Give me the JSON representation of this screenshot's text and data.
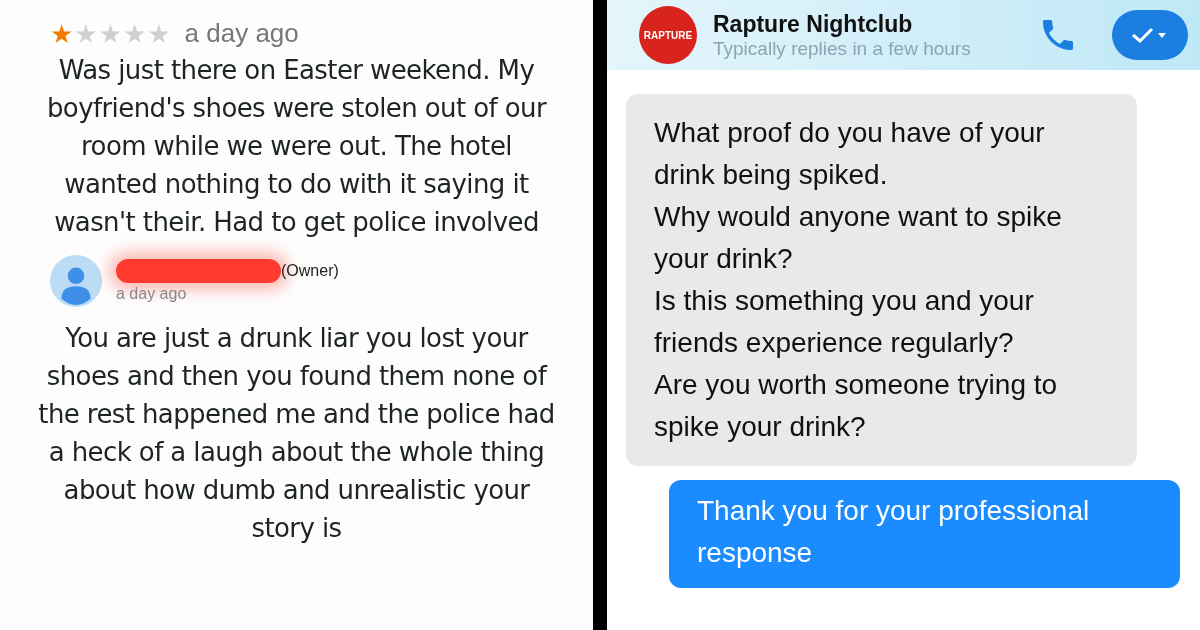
{
  "review": {
    "stars": 1,
    "time": "a day ago",
    "text": "Was just there on Easter weekend. My boyfriend's shoes were stolen out of our room while we were out. The hotel wanted nothing to do with it saying it wasn't their. Had to get police involved"
  },
  "owner_reply": {
    "role": "(Owner)",
    "time": "a day ago",
    "text": "You are just a drunk liar you lost your shoes and then you found them none of the rest happened me and the police had a heck of a laugh about the whole thing about how dumb and unrealistic your story is"
  },
  "chat": {
    "logo": "RAPTURE",
    "name": "Rapture Nightclub",
    "status": "Typically replies in a few hours",
    "messages": [
      {
        "kind": "received",
        "text": "What proof do you have of your drink being spiked.\nWhy would anyone want to spike your drink?\nIs this something you and your friends experience regularly?\nAre you worth someone trying to spike your drink?"
      },
      {
        "kind": "sent",
        "text": "Thank you for your professional response"
      }
    ]
  }
}
